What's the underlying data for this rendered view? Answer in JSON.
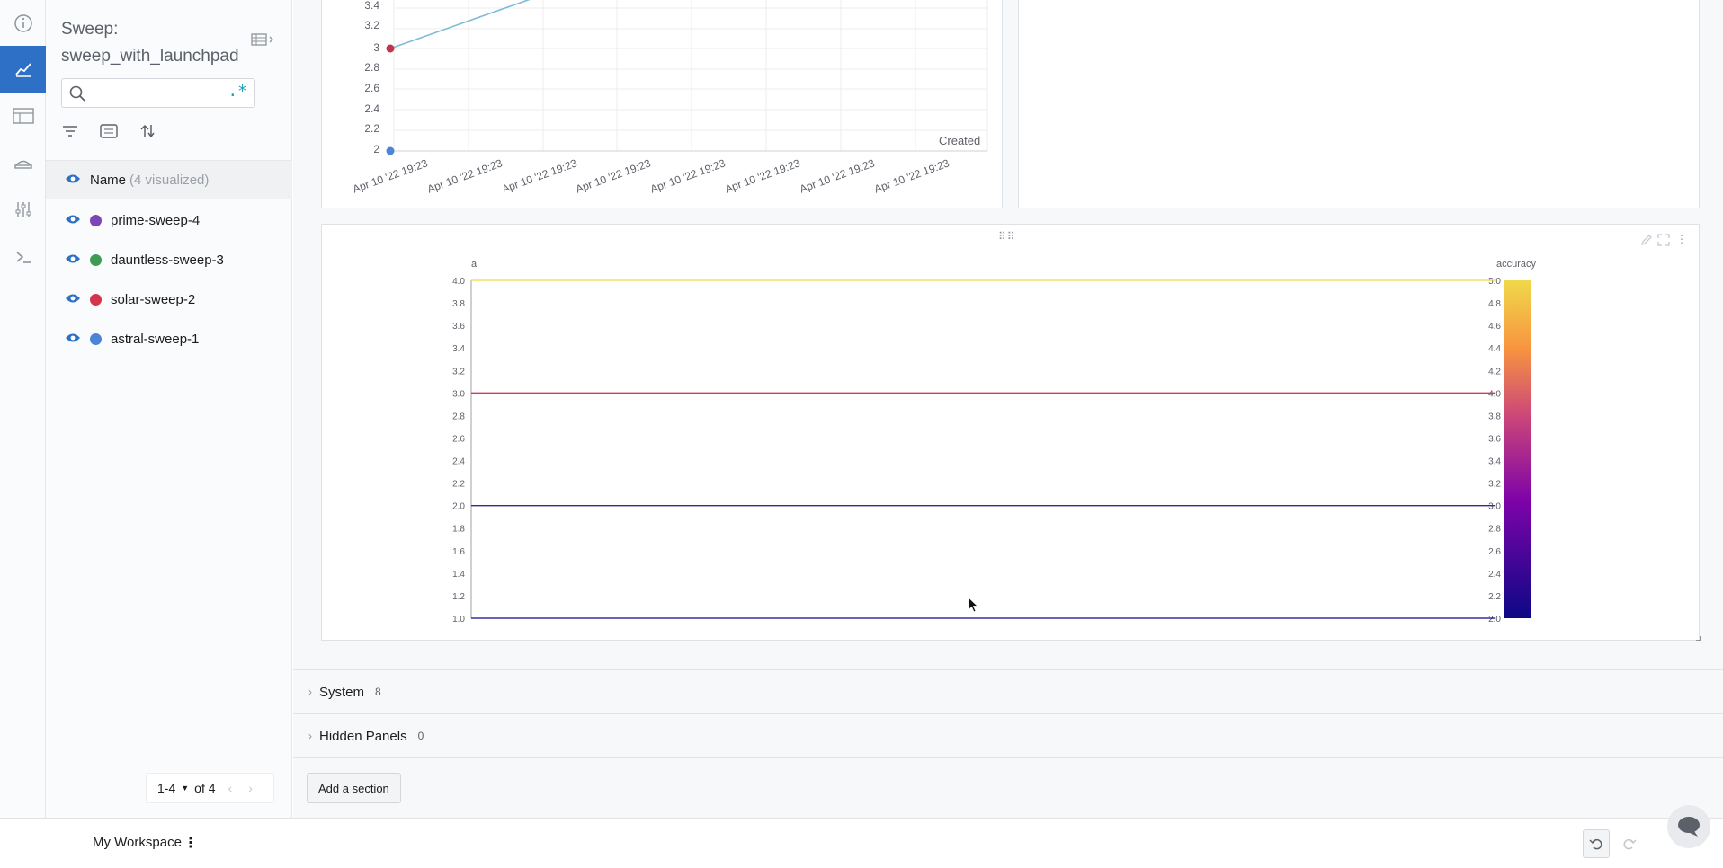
{
  "sidebar": {
    "title_prefix": "Sweep:",
    "title_name": "sweep_with_launchpad",
    "search": {
      "value": "",
      "placeholder": "",
      "regex_label": ".*"
    },
    "name_header": {
      "label": "Name",
      "count": "(4 visualized)"
    },
    "runs": [
      {
        "name": "prime-sweep-4",
        "color": "#7e45b8"
      },
      {
        "name": "dauntless-sweep-3",
        "color": "#3f9a55"
      },
      {
        "name": "solar-sweep-2",
        "color": "#d6344b"
      },
      {
        "name": "astral-sweep-1",
        "color": "#4d84d6"
      }
    ],
    "pager": {
      "range": "1-4",
      "of": "of 4"
    }
  },
  "top_chart": {
    "y_ticks": [
      "3.4",
      "3.2",
      "3",
      "2.8",
      "2.6",
      "2.4",
      "2.2",
      "2"
    ],
    "x_ticks": [
      "Apr 10 '22 19:23",
      "Apr 10 '22 19:23",
      "Apr 10 '22 19:23",
      "Apr 10 '22 19:23",
      "Apr 10 '22 19:23",
      "Apr 10 '22 19:23",
      "Apr 10 '22 19:23",
      "Apr 10 '22 19:23"
    ],
    "x_label": "Created"
  },
  "chart_data": {
    "type": "line",
    "y_axis_label": "a",
    "colorbar_label": "accuracy",
    "y_ticks": [
      "4.0",
      "3.8",
      "3.6",
      "3.4",
      "3.2",
      "3.0",
      "2.8",
      "2.6",
      "2.4",
      "2.2",
      "2.0",
      "1.8",
      "1.6",
      "1.4",
      "1.2",
      "1.0"
    ],
    "colorbar_ticks": [
      "5.0",
      "4.8",
      "4.6",
      "4.4",
      "4.2",
      "4.0",
      "3.8",
      "3.6",
      "3.4",
      "3.2",
      "3.0",
      "2.8",
      "2.6",
      "2.4",
      "2.2",
      "2.0"
    ],
    "ylim": [
      1.0,
      4.0
    ],
    "colorbar_range": [
      2.0,
      5.0
    ],
    "series": [
      {
        "a": 4.0,
        "color": "#f0d84a"
      },
      {
        "a": 3.0,
        "color": "#d8365a"
      },
      {
        "a": 2.0,
        "color": "#4a1b9a"
      },
      {
        "a": 1.0,
        "color": "#0d0887"
      }
    ]
  },
  "sections": [
    {
      "name": "System",
      "count": "8"
    },
    {
      "name": "Hidden Panels",
      "count": "0"
    }
  ],
  "add_section_label": "Add a section",
  "workspace": {
    "label": "My Workspace"
  }
}
